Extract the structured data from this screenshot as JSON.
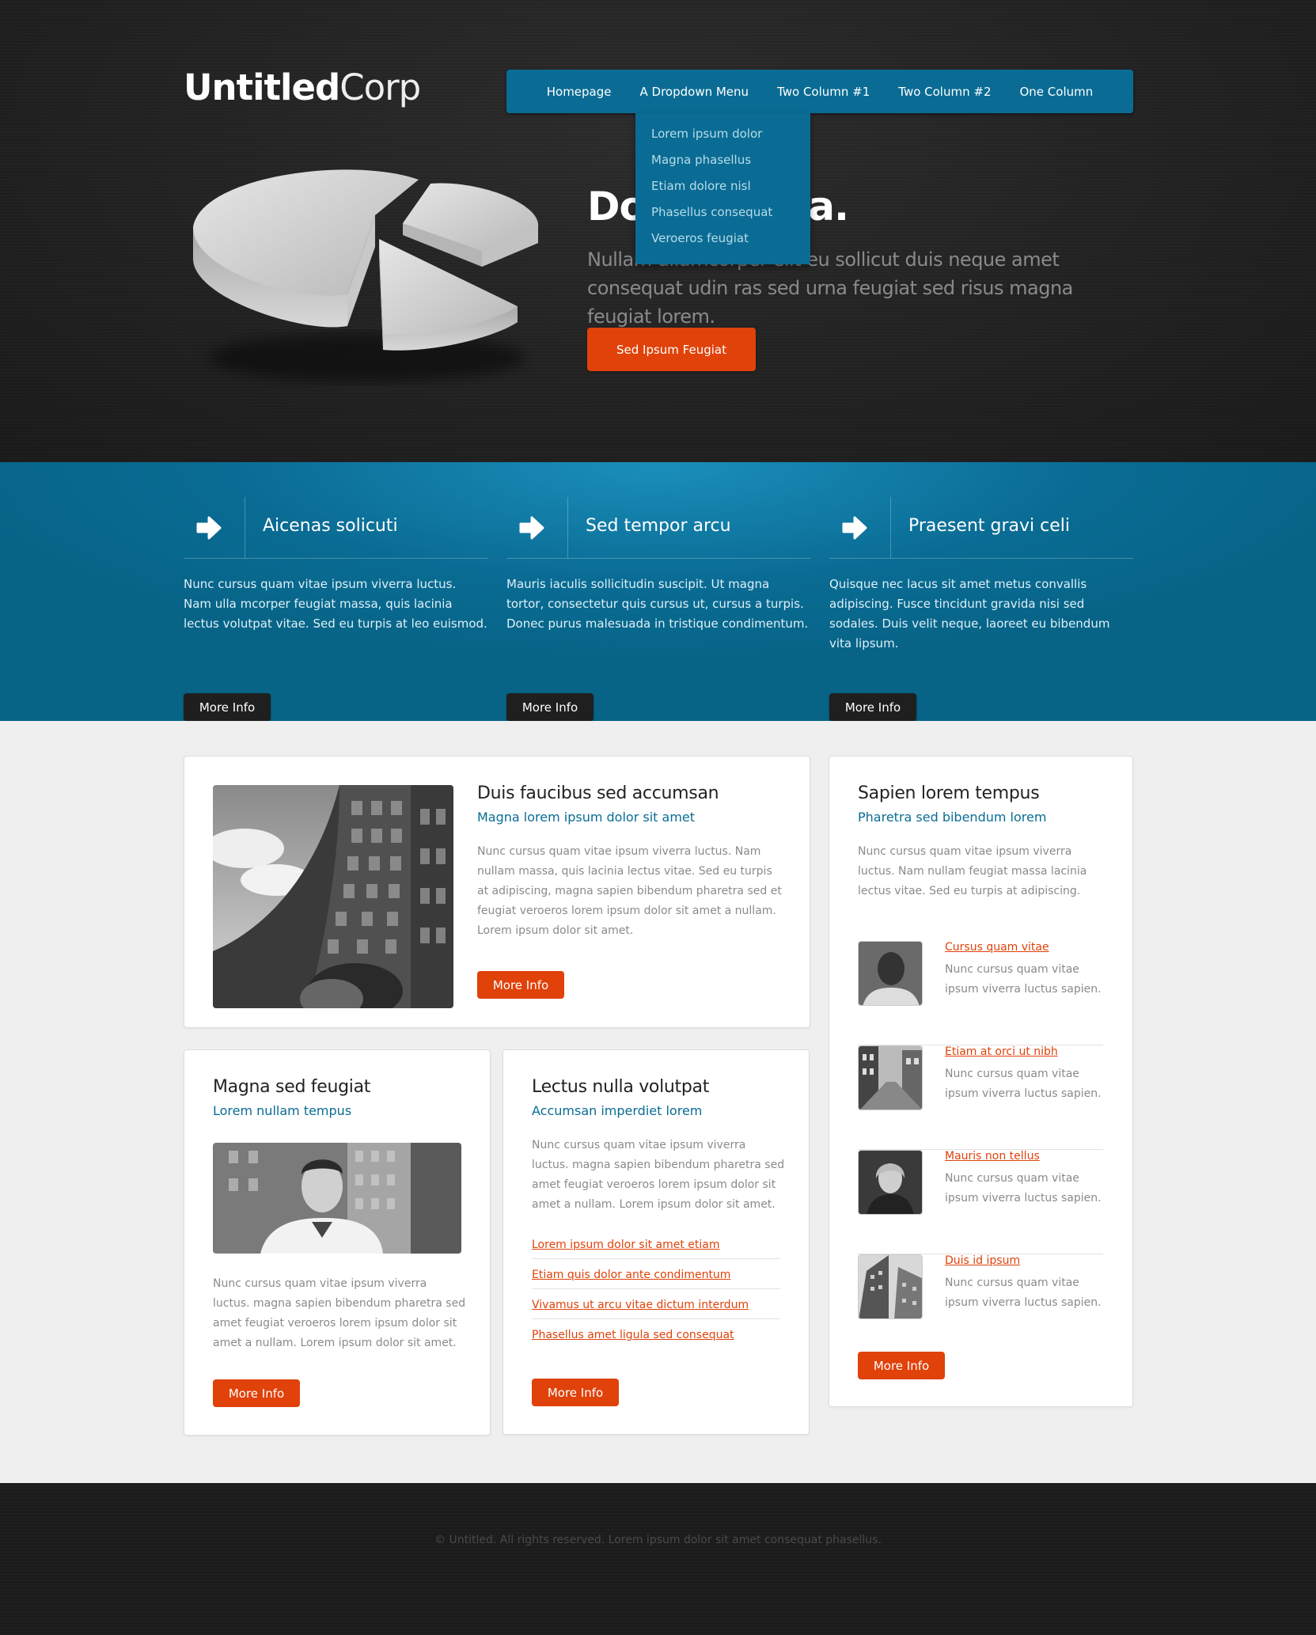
{
  "header": {
    "logo_bold": "Untitled",
    "logo_light": "Corp",
    "nav": [
      "Homepage",
      "A Dropdown Menu",
      "Two Column #1",
      "Two Column #2",
      "One Column"
    ],
    "dropdown": [
      "Lorem ipsum dolor",
      "Magna phasellus",
      "Etiam dolore nisl",
      "Phasellus consequat",
      "Veroeros feugiat"
    ]
  },
  "hero": {
    "title": "Donec urna.",
    "text": "Nullam ullamcorper elit eu sollicut duis neque amet consequat udin ras sed urna feugiat sed risus magna feugiat lorem.",
    "button": "Sed Ipsum Feugiat",
    "colors": {
      "accent": "#e0420a",
      "nav": "#0a6c94"
    }
  },
  "features": [
    {
      "icon": "arrow-right-icon",
      "title": "Aicenas solicuti",
      "text": "Nunc cursus quam vitae ipsum viverra luctus. Nam ulla mcorper feugiat massa, quis lacinia lectus volutpat vitae. Sed eu turpis at leo euismod.",
      "button": "More Info"
    },
    {
      "icon": "arrow-right-icon",
      "title": "Sed tempor arcu",
      "text": "Mauris iaculis sollicitudin suscipit. Ut magna tortor, consectetur quis cursus ut, cursus a turpis. Donec purus malesuada in tristique condimentum.",
      "button": "More Info"
    },
    {
      "icon": "arrow-right-icon",
      "title": "Praesent gravi celi",
      "text": "Quisque nec lacus sit amet metus convallis adipiscing. Fusce tincidunt gravida nisi sed sodales. Duis velit neque, laoreet eu bibendum vita lipsum.",
      "button": "More Info"
    }
  ],
  "box1": {
    "title": "Duis faucibus sed accumsan",
    "subtitle": "Magna lorem ipsum dolor sit amet",
    "text": "Nunc cursus quam vitae ipsum viverra luctus. Nam nullam massa, quis lacinia lectus vitae. Sed eu turpis at adipiscing, magna sapien bibendum pharetra sed et feugiat veroeros lorem ipsum dolor sit amet a nullam. Lorem ipsum dolor sit amet.",
    "button": "More Info"
  },
  "box2": {
    "title": "Magna sed feugiat",
    "subtitle": "Lorem nullam tempus",
    "text": "Nunc cursus quam vitae ipsum viverra luctus. magna sapien bibendum pharetra sed amet feugiat veroeros lorem ipsum dolor sit amet a nullam. Lorem ipsum dolor sit amet.",
    "button": "More Info"
  },
  "box3": {
    "title": "Lectus nulla volutpat",
    "subtitle": "Accumsan imperdiet lorem",
    "text": "Nunc cursus quam vitae ipsum viverra luctus. magna sapien bibendum pharetra sed amet feugiat veroeros lorem ipsum dolor sit amet a nullam. Lorem ipsum dolor sit amet.",
    "links": [
      "Lorem ipsum dolor sit amet etiam",
      "Etiam quis dolor ante condimentum",
      "Vivamus ut arcu vitae dictum interdum",
      "Phasellus amet ligula sed consequat"
    ],
    "button": "More Info"
  },
  "box4": {
    "title": "Sapien lorem tempus",
    "subtitle": "Pharetra sed bibendum lorem",
    "text": "Nunc cursus quam vitae ipsum viverra luctus. Nam nullam feugiat massa lacinia lectus vitae. Sed eu turpis at adipiscing.",
    "items": [
      {
        "title": "Cursus quam vitae",
        "text": "Nunc cursus quam vitae ipsum viverra luctus sapien."
      },
      {
        "title": "Etiam at orci ut nibh",
        "text": "Nunc cursus quam vitae ipsum viverra luctus sapien."
      },
      {
        "title": "Mauris non tellus",
        "text": "Nunc cursus quam vitae ipsum viverra luctus sapien."
      },
      {
        "title": "Duis id ipsum",
        "text": "Nunc cursus quam vitae ipsum viverra luctus sapien."
      }
    ],
    "button": "More Info"
  },
  "footer": {
    "copyright": "© Untitled. All rights reserved. Lorem ipsum dolor sit amet consequat phasellus."
  }
}
